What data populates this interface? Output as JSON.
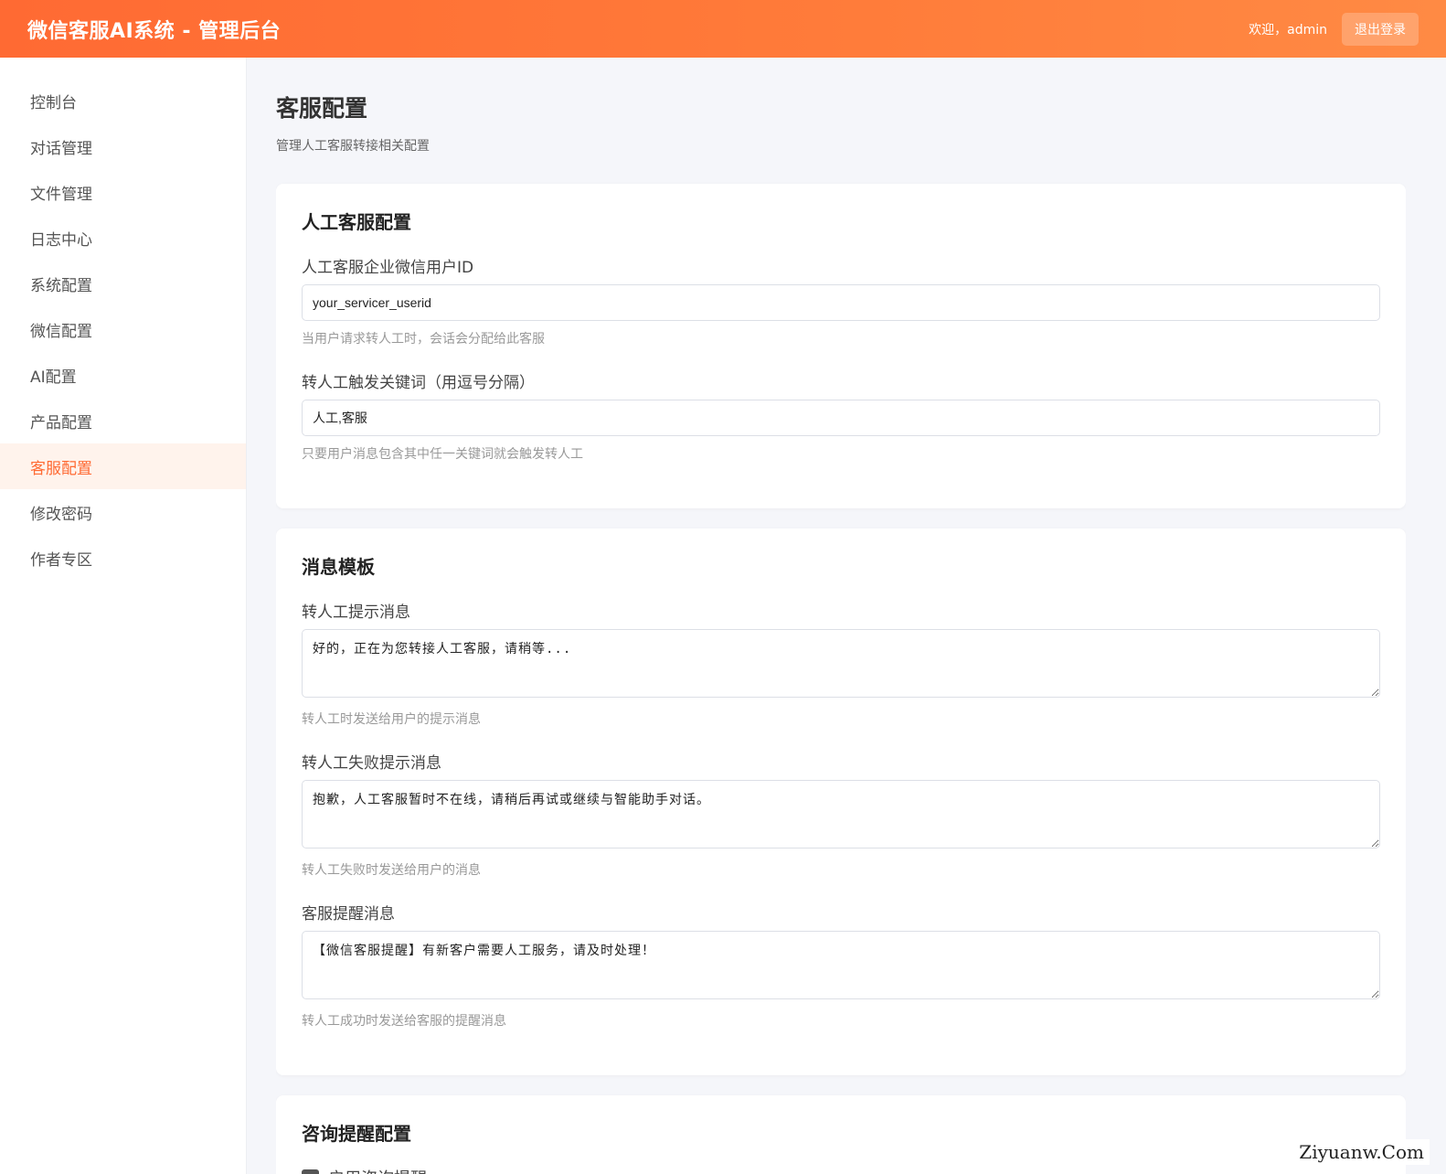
{
  "header": {
    "title": "微信客服AI系统 - 管理后台",
    "welcome": "欢迎，admin",
    "logout_label": "退出登录"
  },
  "sidebar": {
    "items": [
      {
        "label": "控制台"
      },
      {
        "label": "对话管理"
      },
      {
        "label": "文件管理"
      },
      {
        "label": "日志中心"
      },
      {
        "label": "系统配置"
      },
      {
        "label": "微信配置"
      },
      {
        "label": "AI配置"
      },
      {
        "label": "产品配置"
      },
      {
        "label": "客服配置",
        "active": true
      },
      {
        "label": "修改密码"
      },
      {
        "label": "作者专区"
      }
    ]
  },
  "page": {
    "title": "客服配置",
    "subtitle": "管理人工客服转接相关配置"
  },
  "servicer": {
    "title": "人工客服配置",
    "userid_label": "人工客服企业微信用户ID",
    "userid_value": "your_servicer_userid",
    "userid_hint": "当用户请求转人工时，会话会分配给此客服",
    "keywords_label": "转人工触发关键词（用逗号分隔）",
    "keywords_value": "人工,客服",
    "keywords_hint": "只要用户消息包含其中任一关键词就会触发转人工"
  },
  "templates": {
    "title": "消息模板",
    "transfer_label": "转人工提示消息",
    "transfer_value": "好的，正在为您转接人工客服，请稍等...",
    "transfer_hint": "转人工时发送给用户的提示消息",
    "fail_label": "转人工失败提示消息",
    "fail_value": "抱歉，人工客服暂时不在线，请稍后再试或继续与智能助手对话。",
    "fail_hint": "转人工失败时发送给用户的消息",
    "remind_label": "客服提醒消息",
    "remind_value": "【微信客服提醒】有新客户需要人工服务，请及时处理！",
    "remind_hint": "转人工成功时发送给客服的提醒消息"
  },
  "consult": {
    "title": "咨询提醒配置",
    "enable_label": "启用咨询提醒",
    "enabled": true
  },
  "watermark": "Ziyuanw.Com"
}
